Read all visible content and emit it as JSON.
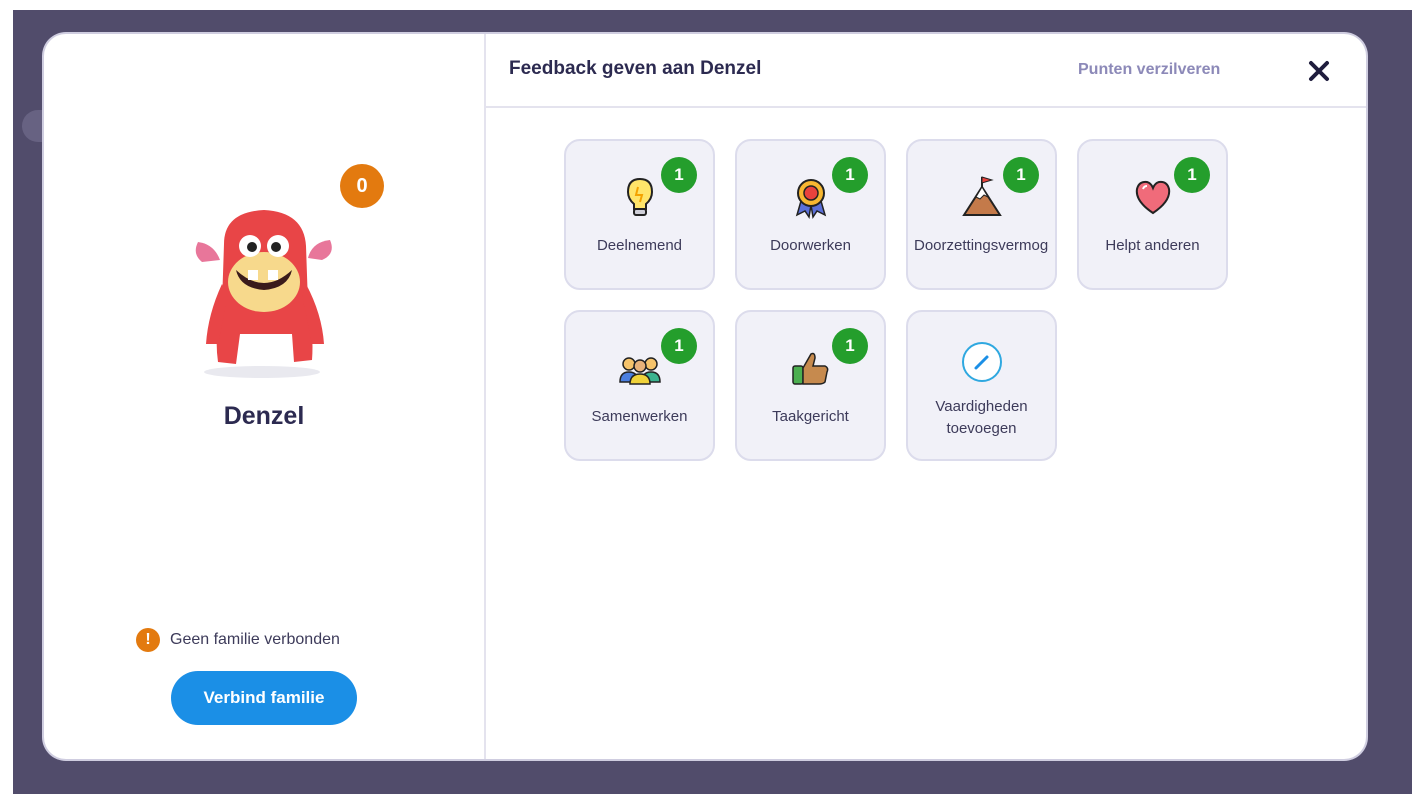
{
  "header": {
    "title": "Feedback geven aan Denzel",
    "redeem_label": "Punten verzilveren",
    "close_icon": "close-icon"
  },
  "student": {
    "name": "Denzel",
    "points": "0",
    "avatar": "red-monster-avatar"
  },
  "family": {
    "warning_icon": "warning-icon",
    "status_text": "Geen familie verbonden",
    "connect_label": "Verbind familie"
  },
  "skills": [
    {
      "label": "Deelnemend",
      "count": "1",
      "icon": "lightbulb-icon"
    },
    {
      "label": "Doorwerken",
      "count": "1",
      "icon": "medal-icon"
    },
    {
      "label": "Doorzettingsvermogen",
      "count": "1",
      "icon": "mountain-flag-icon"
    },
    {
      "label": "Helpt anderen",
      "count": "1",
      "icon": "heart-icon"
    },
    {
      "label": "Samenwerken",
      "count": "1",
      "icon": "people-icon"
    },
    {
      "label": "Taakgericht",
      "count": "1",
      "icon": "thumbs-up-icon"
    },
    {
      "label": "Vaardigheden toevoegen",
      "icon": "pencil-circle-icon"
    }
  ],
  "colors": {
    "backdrop": "#514c6b",
    "count_badge": "#249e2c",
    "points_badge": "#e37a0f",
    "primary_button": "#1b8fe6"
  }
}
